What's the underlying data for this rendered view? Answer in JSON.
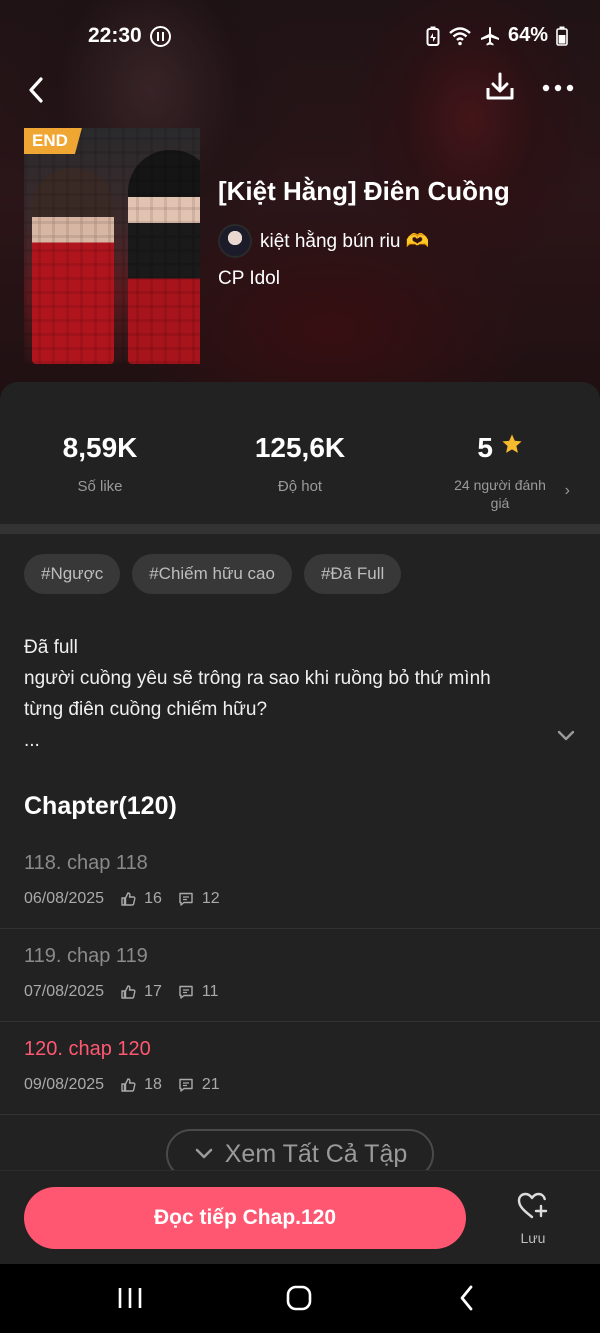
{
  "status_bar": {
    "time": "22:30",
    "battery": "64%",
    "icons": [
      "dnd-icon",
      "battery-saver-icon",
      "wifi-icon",
      "airplane-icon",
      "battery-icon"
    ]
  },
  "nav": {
    "icons": [
      "back-icon",
      "download-icon",
      "more-icon"
    ]
  },
  "book": {
    "badge": "END",
    "title": "[Kiệt Hằng] Điên Cuồng",
    "author": "kiệt hằng bún riu 🫶",
    "category": "CP Idol"
  },
  "stats": {
    "likes_value": "8,59K",
    "likes_label": "Số like",
    "hot_value": "125,6K",
    "hot_label": "Độ hot",
    "rating_value": "5",
    "rating_label": "24 người đánh giá"
  },
  "tags": [
    "#Ngược",
    "#Chiếm hữu cao",
    "#Đã Full"
  ],
  "description": {
    "line1": "Đã full",
    "line2": "người cuồng yêu sẽ trông ra sao khi ruồng bỏ thứ mình",
    "line3": "từng điên cuồng chiếm hữu?",
    "line4": "..."
  },
  "chapters": {
    "heading": "Chapter(120)",
    "items": [
      {
        "title": "118. chap 118",
        "date": "06/08/2025",
        "likes": "16",
        "comments": "12",
        "current": false
      },
      {
        "title": "119. chap 119",
        "date": "07/08/2025",
        "likes": "17",
        "comments": "11",
        "current": false
      },
      {
        "title": "120. chap 120",
        "date": "09/08/2025",
        "likes": "18",
        "comments": "21",
        "current": true
      }
    ],
    "view_all": "Xem Tất Cả Tập"
  },
  "bottom": {
    "read_label": "Đọc tiếp Chap.120",
    "save_label": "Lưu"
  },
  "colors": {
    "accent": "#ff5671",
    "current_chapter": "#ff5871",
    "badge": "#f0a632",
    "star": "#f7b92d",
    "background": "#222222"
  }
}
